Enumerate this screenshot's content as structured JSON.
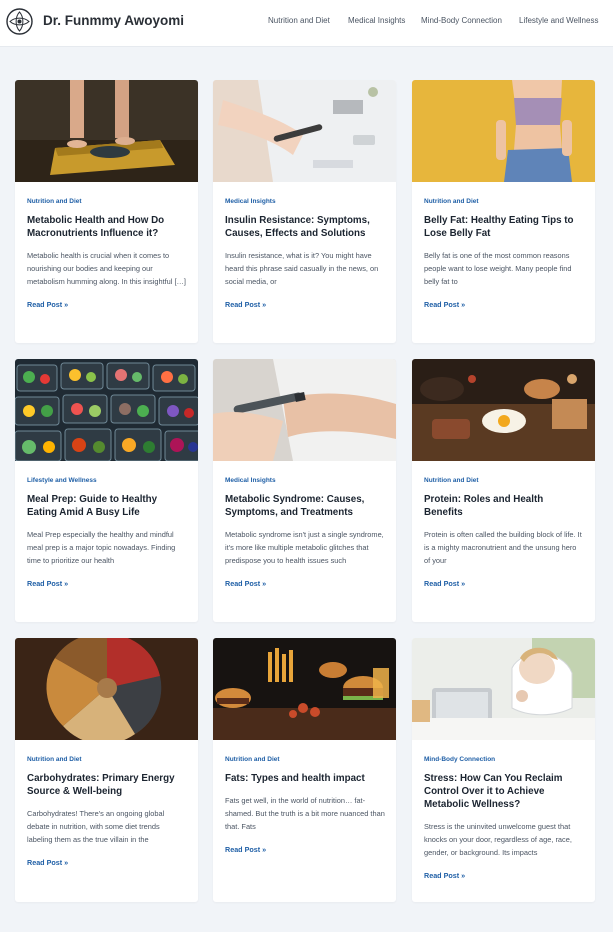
{
  "site": {
    "title": "Dr. Funmmy Awoyomi"
  },
  "nav": [
    "Nutrition and Diet",
    "Medical Insights",
    "Mind-Body Connection",
    "Lifestyle and Wellness"
  ],
  "posts": [
    {
      "category": "Nutrition and Diet",
      "title": "Metabolic Health and How Do Macronutrients Influence it?",
      "excerpt": "Metabolic health is crucial when it comes to nourishing our bodies and keeping our metabolism humming along. In this insightful […]",
      "read_more": "Read Post »",
      "image": "bathroom-scale-feet"
    },
    {
      "category": "Medical Insights",
      "title": "Insulin Resistance: Symptoms, Causes, Effects and Solutions",
      "excerpt": "Insulin resistance, what is it? You might have heard this phrase said casually in the news, on social media, or",
      "read_more": "Read Post »",
      "image": "glucose-test-desk"
    },
    {
      "category": "Nutrition and Diet",
      "title": "Belly Fat: Healthy Eating Tips to Lose Belly Fat",
      "excerpt": "Belly fat is one of the most common reasons people want to lose weight. Many people find belly fat to",
      "read_more": "Read Post »",
      "image": "woman-loose-jeans"
    },
    {
      "category": "Lifestyle and Wellness",
      "title": "Meal Prep: Guide to Healthy Eating Amid A Busy Life",
      "excerpt": "Meal Prep especially the healthy and mindful meal prep is a major topic nowadays. Finding time to prioritize our health",
      "read_more": "Read Post »",
      "image": "meal-prep-containers"
    },
    {
      "category": "Medical Insights",
      "title": "Metabolic Syndrome: Causes, Symptoms, and Treatments",
      "excerpt": "Metabolic syndrome isn't just a single syndrome, it's more like multiple metabolic glitches that predispose you to health issues such",
      "read_more": "Read Post »",
      "image": "insulin-injection"
    },
    {
      "category": "Nutrition and Diet",
      "title": "Protein: Roles and Health Benefits",
      "excerpt": "Protein is often called the building block of life. It is a mighty macronutrient and the unsung hero of your",
      "read_more": "Read Post »",
      "image": "breakfast-board"
    },
    {
      "category": "Nutrition and Diet",
      "title": "Carbohydrates: Primary Energy Source & Well-being",
      "excerpt": "Carbohydrates! There's an ongoing global debate in nutrition, with some diet trends labeling them as the true villain in the",
      "read_more": "Read Post »",
      "image": "grains-bowl"
    },
    {
      "category": "Nutrition and Diet",
      "title": "Fats: Types and health impact",
      "excerpt": "Fats get well, in the world of nutrition… fat-shamed. But the truth is a bit more nuanced than that. Fats",
      "read_more": "Read Post »",
      "image": "burgers-fries"
    },
    {
      "category": "Mind-Body Connection",
      "title": "Stress: How Can You Reclaim Control Over it to Achieve Metabolic Wellness?",
      "excerpt": "Stress is the uninvited unwelcome guest that knocks on your door, regardless of age, race, gender, or background. Its impacts",
      "read_more": "Read Post »",
      "image": "stressed-woman-laptop"
    }
  ]
}
